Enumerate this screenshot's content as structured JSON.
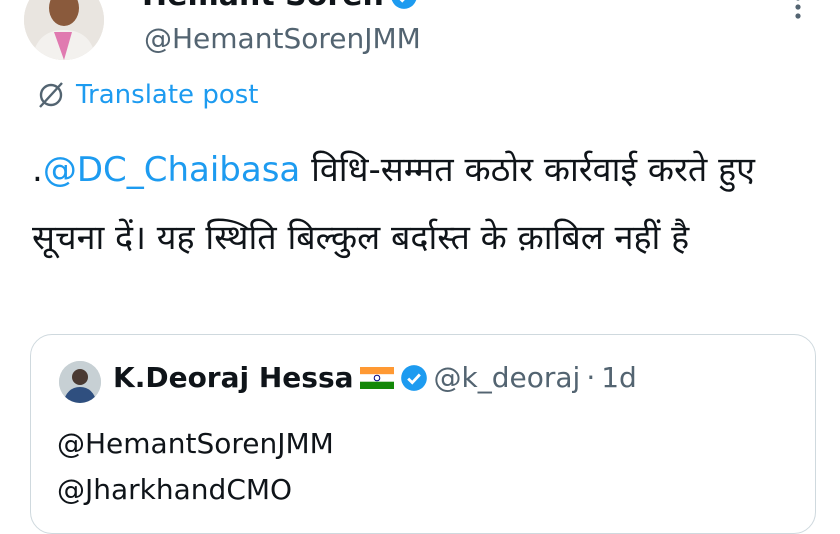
{
  "author": {
    "name": "Hemant Soren",
    "handle": "@HemantSorenJMM"
  },
  "translate_label": "Translate post",
  "post": {
    "prefix": ".",
    "mention": "@DC_Chaibasa",
    "text": " विधि-सम्मत कठोर कार्रवाई करते हुए सूचना दें। यह स्थिति बिल्कुल बर्दास्त के क़ाबिल नहीं है"
  },
  "quoted": {
    "name": "K.Deoraj Hessa",
    "handle": "@k_deoraj",
    "separator": "·",
    "time": "1d",
    "line1": "@HemantSorenJMM",
    "line2": "@JharkhandCMO"
  },
  "colors": {
    "accent": "#1d9bf0",
    "text": "#0f1419",
    "muted": "#536471",
    "border": "#cfd9de"
  },
  "icons": [
    "verified-badge-icon",
    "more-options-icon",
    "translate-icon",
    "india-flag-icon"
  ]
}
